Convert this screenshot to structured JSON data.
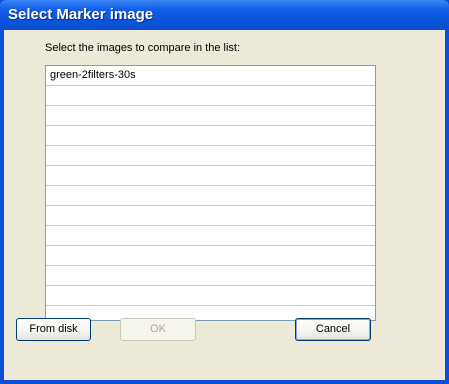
{
  "window": {
    "title": "Select Marker image"
  },
  "dialog": {
    "instruction": "Select the images to compare in the list:",
    "items": [
      "green-2filters-30s",
      "",
      "",
      "",
      "",
      "",
      "",
      "",
      "",
      "",
      "",
      "",
      ""
    ]
  },
  "buttons": {
    "from_disk": "From disk",
    "ok": "OK",
    "cancel": "Cancel"
  },
  "colors": {
    "titlebar": "#0a4fd6",
    "client_background": "#ece9d8",
    "list_border": "#7f9db9"
  }
}
